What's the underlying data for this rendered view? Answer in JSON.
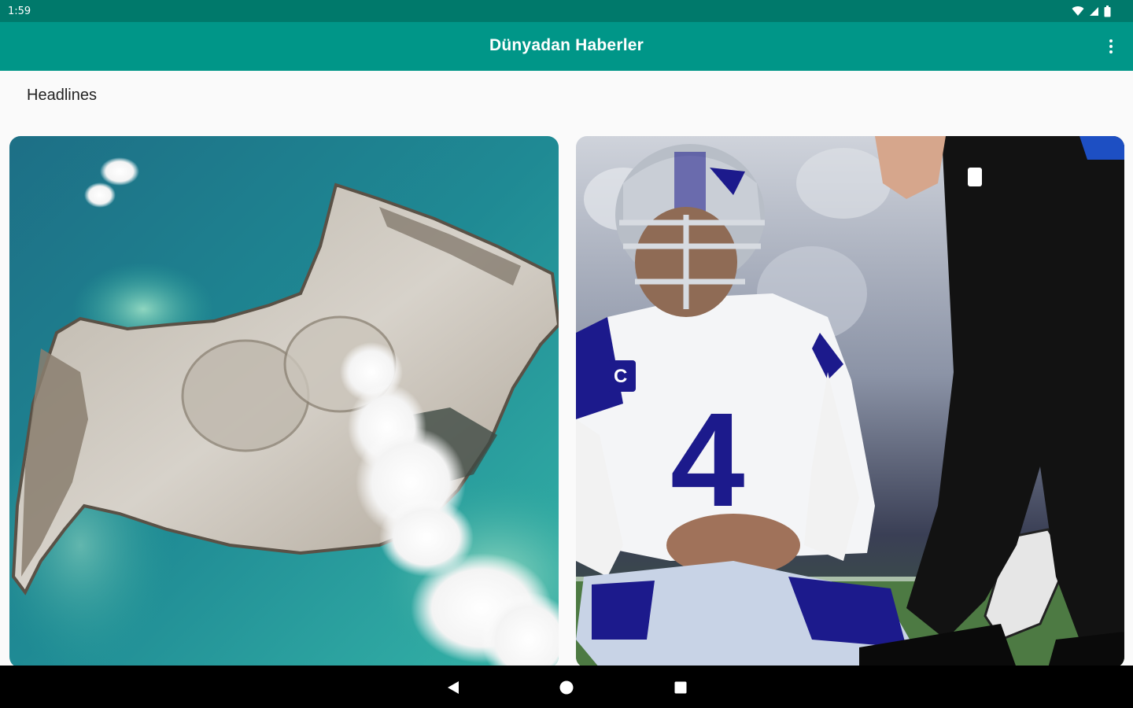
{
  "status_bar": {
    "time": "1:59",
    "icons": [
      "wifi-icon",
      "signal-icon",
      "battery-icon"
    ]
  },
  "app_bar": {
    "title": "Dünyadan Haberler",
    "menu_icon": "more-vert-icon"
  },
  "headlines": {
    "section_title": "Headlines",
    "cards": [
      {
        "image": "volcanic-island-satellite-image"
      },
      {
        "image": "football-quarterback-sitting-image"
      }
    ]
  },
  "nav_bar": {
    "buttons": [
      "back-icon",
      "home-icon",
      "recents-icon"
    ]
  },
  "colors": {
    "status_bar": "#00796b",
    "app_bar": "#009688",
    "background": "#fafafa",
    "nav_bar": "#000000"
  }
}
